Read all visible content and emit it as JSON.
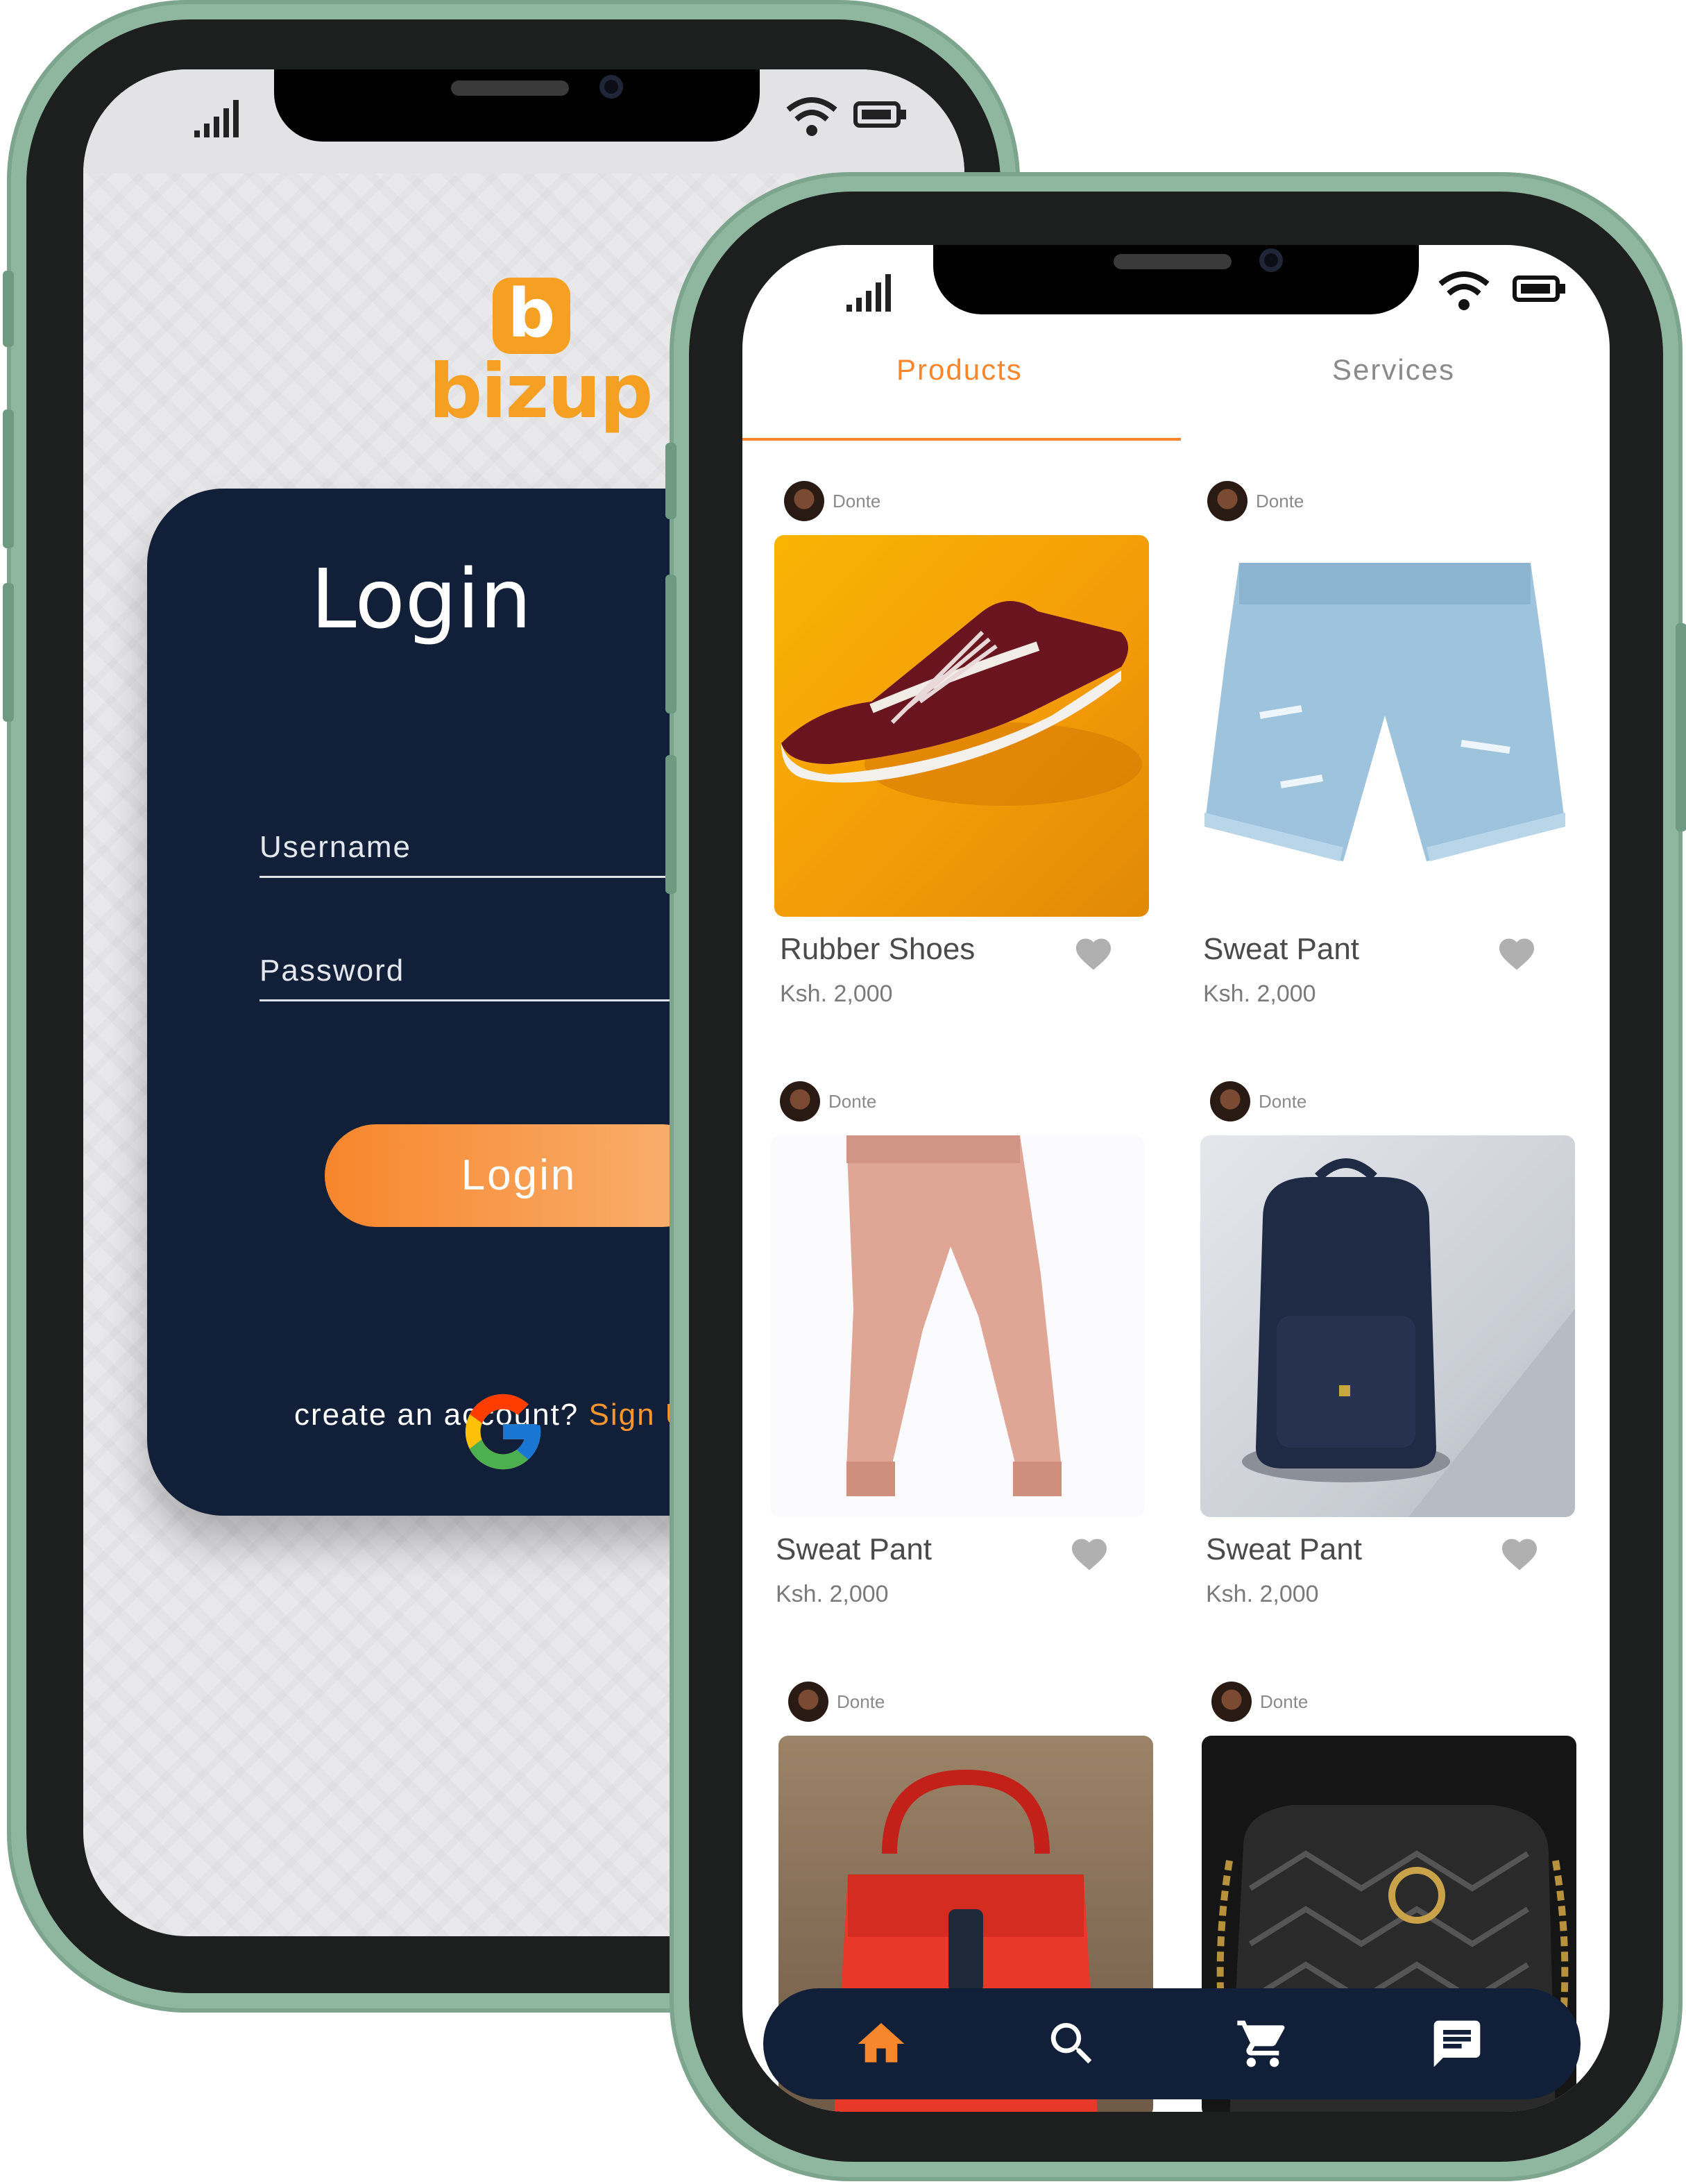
{
  "login_screen": {
    "brand": {
      "logo_letter": "b",
      "name": "bizup",
      "color": "#f5a022"
    },
    "card": {
      "title": "Login",
      "username_placeholder": "Username",
      "password_placeholder": "Password",
      "login_button": "Login",
      "signup_prompt": "create an account?",
      "signup_link": "Sign Up"
    },
    "social": {
      "icon": "google-icon"
    }
  },
  "shop_screen": {
    "tabs": [
      {
        "label": "Products",
        "active": true
      },
      {
        "label": "Services",
        "active": false
      }
    ],
    "products": [
      {
        "seller": "Donte",
        "name": "Rubber Shoes",
        "price": "Ksh. 2,000",
        "image": "red-sneaker"
      },
      {
        "seller": "Donte",
        "name": "Sweat Pant",
        "price": "Ksh. 2,000",
        "image": "denim-shorts"
      },
      {
        "seller": "Donte",
        "name": "Sweat Pant",
        "price": "Ksh. 2,000",
        "image": "pink-joggers"
      },
      {
        "seller": "Donte",
        "name": "Sweat Pant",
        "price": "Ksh. 2,000",
        "image": "navy-backpack"
      },
      {
        "seller": "Donte",
        "name": "",
        "price": "",
        "image": "red-handbag"
      },
      {
        "seller": "Donte",
        "name": "",
        "price": "",
        "image": "black-gucci-bag"
      }
    ],
    "bottom_nav": [
      {
        "icon": "home-icon",
        "active": true
      },
      {
        "icon": "search-icon",
        "active": false
      },
      {
        "icon": "cart-icon",
        "active": false
      },
      {
        "icon": "chat-icon",
        "active": false
      }
    ]
  },
  "colors": {
    "accent": "#f7862c",
    "navy": "#112038",
    "frame": "#8fb7a0"
  }
}
